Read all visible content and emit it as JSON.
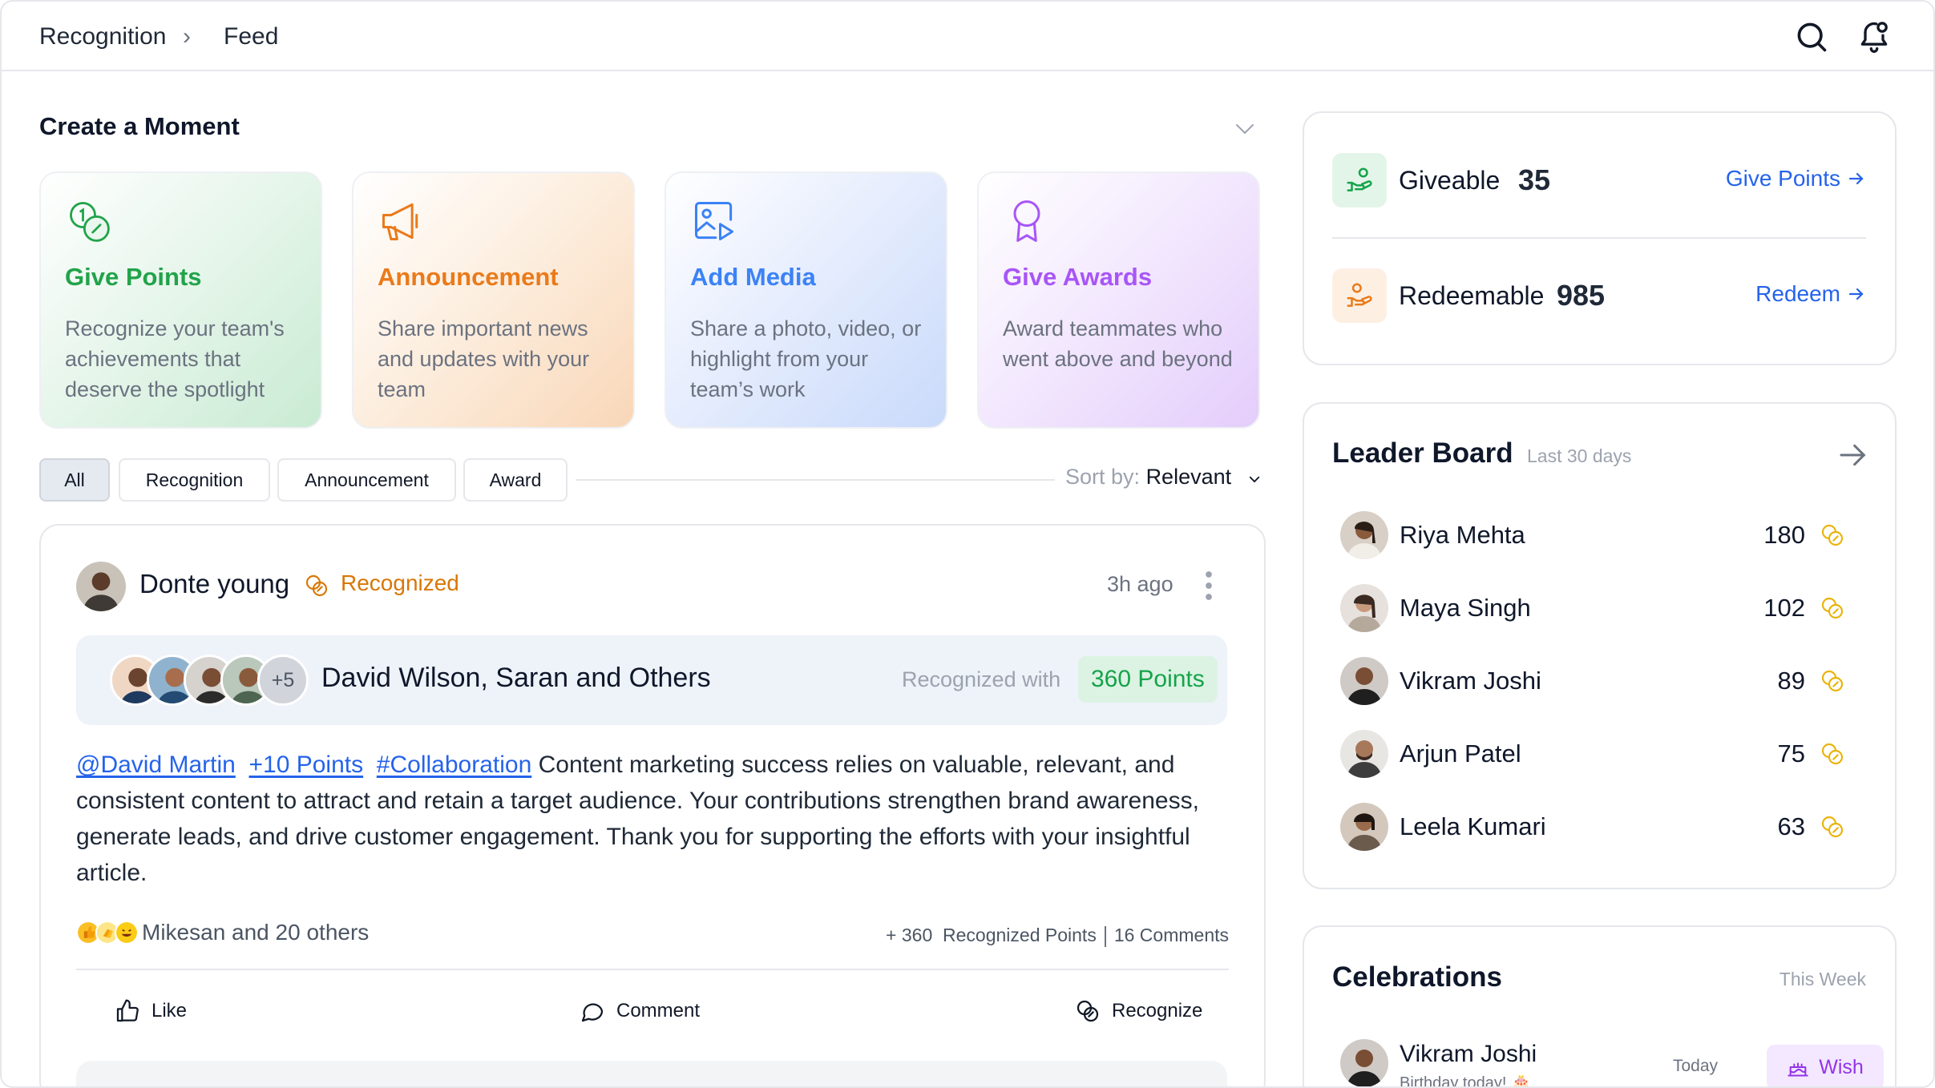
{
  "breadcrumb": {
    "parent": "Recognition",
    "current": "Feed",
    "separator": "›"
  },
  "icons": [
    "search-icon",
    "bell-icon",
    "chevron-down-icon",
    "coin-icon",
    "megaphone-icon",
    "image-icon",
    "award-icon",
    "more-vertical-icon",
    "thumbs-up-icon",
    "comment-icon",
    "hand-coins-icon",
    "arrow-right-icon",
    "cake-icon"
  ],
  "colors": {
    "green": "#22a34a",
    "orange": "#ea7a1a",
    "blue": "#3b82f6",
    "purple": "#a855f7",
    "link": "#2563eb",
    "gold": "#d97706"
  },
  "create_moment": {
    "title": "Create a Moment",
    "cards": [
      {
        "title": "Give Points",
        "desc": "Recognize your team's achievements that deserve the spotlight"
      },
      {
        "title": "Announcement",
        "desc": "Share important news and updates with your team"
      },
      {
        "title": "Add Media",
        "desc": "Share a photo, video, or highlight from your team’s work"
      },
      {
        "title": "Give Awards",
        "desc": "Award teammates who went above and beyond"
      }
    ]
  },
  "filters": {
    "tabs": [
      "All",
      "Recognition",
      "Announcement",
      "Award"
    ],
    "active": "All",
    "sort_label": "Sort by:",
    "sort_value": "Relevant"
  },
  "post": {
    "author": "Donte young",
    "action": "Recognized",
    "time": "3h ago",
    "recipients_extra": "+5",
    "recipients": "David Wilson, Saran and Others",
    "recognized_with": "Recognized with",
    "points": "360 Points",
    "mention": "@David Martin",
    "points_tag": "+10 Points",
    "hashtag": "#Collaboration",
    "body": "Content marketing success relies on valuable, relevant, and consistent content to attract and retain a target audience. Your contributions strengthen brand awareness, generate leads, and drive customer engagement. Thank you for supporting the efforts with your insightful article.",
    "reactions_text": "Mikesan and 20 others",
    "stats_points": "+ 360",
    "stats_points_label": "Recognized Points",
    "stats_comments": "16 Comments",
    "actions": {
      "like": "Like",
      "comment": "Comment",
      "recognize": "Recognize"
    }
  },
  "points": {
    "giveable_label": "Giveable",
    "giveable_value": "35",
    "give_link": "Give Points",
    "redeemable_label": "Redeemable",
    "redeemable_value": "985",
    "redeem_link": "Redeem"
  },
  "leaderboard": {
    "title": "Leader Board",
    "subtitle": "Last 30 days",
    "rows": [
      {
        "name": "Riya Mehta",
        "score": "180"
      },
      {
        "name": "Maya Singh",
        "score": "102"
      },
      {
        "name": "Vikram Joshi",
        "score": "89"
      },
      {
        "name": "Arjun Patel",
        "score": "75"
      },
      {
        "name": "Leela Kumari",
        "score": "63"
      }
    ]
  },
  "celebrations": {
    "title": "Celebrations",
    "period": "This Week",
    "items": [
      {
        "name": "Vikram Joshi",
        "note": "Birthday today! 🎂",
        "when": "Today",
        "action": "Wish"
      }
    ]
  }
}
